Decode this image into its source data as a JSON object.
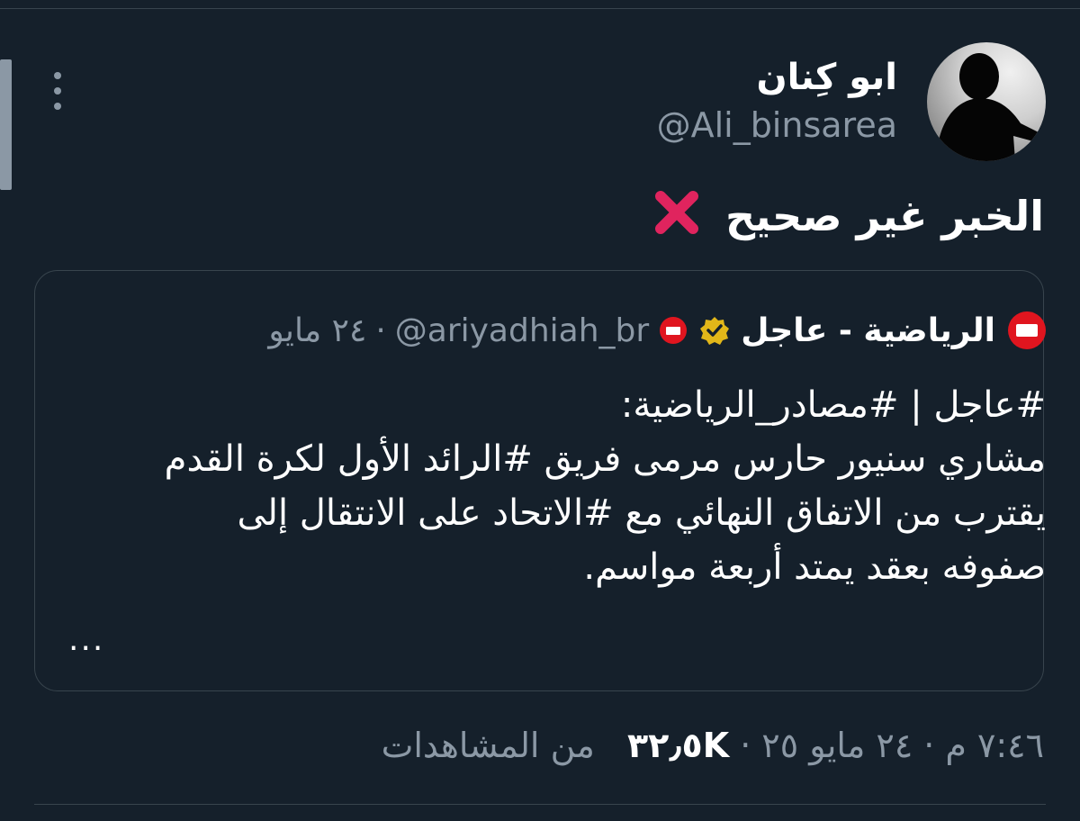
{
  "author": {
    "display_name": "ابو كِنان",
    "handle": "@Ali_binsarea",
    "avatar_icon": "avatar-silhouette-icon"
  },
  "tweet": {
    "text": "الخبر غير صحيح",
    "emoji_icon": "cross-mark-icon",
    "more_icon": "more-dots-icon"
  },
  "quoted_tweet": {
    "account_name": "الرياضية - عاجل",
    "verified_icon": "verified-gold-badge-icon",
    "handle": "@ariyadhiah_br",
    "separator": "·",
    "date": "٢٤ مايو",
    "body_lines": [
      "#عاجل | #مصادر_الرياضية:",
      "مشاري سنيور حارس مرمى فريق #الرائد الأول لكرة القدم",
      "يقترب من الاتفاق النهائي مع #الاتحاد على الانتقال إلى",
      "صفوفه بعقد يمتد أربعة مواسم."
    ],
    "ellipsis": "..."
  },
  "meta": {
    "time": "٧:٤٦ م",
    "separator": "·",
    "date": "٢٤ مايو ٢٥",
    "views_count": "٣٢٫٥K",
    "views_label": "من المشاهدات"
  },
  "colors": {
    "background": "#15202b",
    "border": "#38444d",
    "secondary_text": "#8b98a5",
    "brand_red": "#e0151f",
    "verified_gold": "#e2b719"
  }
}
